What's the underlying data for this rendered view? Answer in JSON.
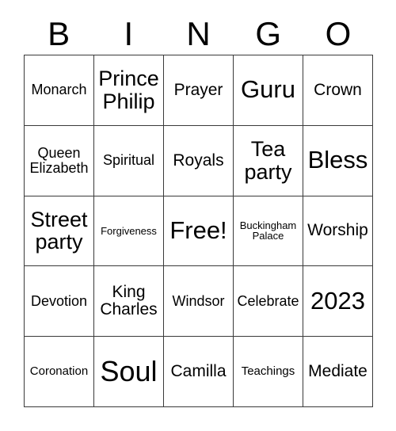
{
  "header": {
    "letters": [
      "B",
      "I",
      "N",
      "G",
      "O"
    ]
  },
  "grid": {
    "rows": [
      [
        {
          "text": "Monarch",
          "size": "s-md"
        },
        {
          "text": "Prince Philip",
          "size": "s-xl"
        },
        {
          "text": "Prayer",
          "size": "s-lg"
        },
        {
          "text": "Guru",
          "size": "s-xxl"
        },
        {
          "text": "Crown",
          "size": "s-lg"
        }
      ],
      [
        {
          "text": "Queen Elizabeth",
          "size": "s-md"
        },
        {
          "text": "Spiritual",
          "size": "s-md"
        },
        {
          "text": "Royals",
          "size": "s-lg"
        },
        {
          "text": "Tea party",
          "size": "s-xl"
        },
        {
          "text": "Bless",
          "size": "s-xxl"
        }
      ],
      [
        {
          "text": "Street party",
          "size": "s-xl"
        },
        {
          "text": "Forgiveness",
          "size": "s-xs"
        },
        {
          "text": "Free!",
          "size": "s-xxl"
        },
        {
          "text": "Buckingham Palace",
          "size": "s-xs"
        },
        {
          "text": "Worship",
          "size": "s-lg"
        }
      ],
      [
        {
          "text": "Devotion",
          "size": "s-md"
        },
        {
          "text": "King Charles",
          "size": "s-lg"
        },
        {
          "text": "Windsor",
          "size": "s-md"
        },
        {
          "text": "Celebrate",
          "size": "s-md"
        },
        {
          "text": "2023",
          "size": "s-xxl"
        }
      ],
      [
        {
          "text": "Coronation",
          "size": "s-sm"
        },
        {
          "text": "Soul",
          "size": "s-huge"
        },
        {
          "text": "Camilla",
          "size": "s-lg"
        },
        {
          "text": "Teachings",
          "size": "s-sm"
        },
        {
          "text": "Mediate",
          "size": "s-lg"
        }
      ]
    ]
  }
}
